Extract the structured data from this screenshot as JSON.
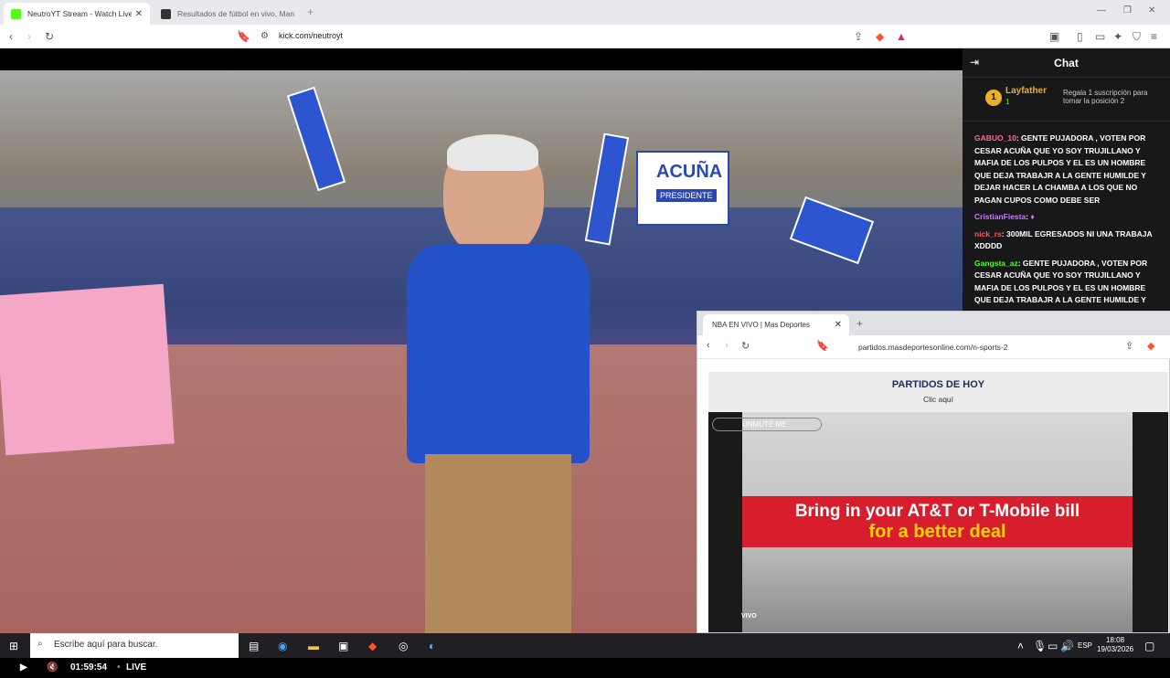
{
  "browser": {
    "tabs": [
      {
        "title": "NeutroYT Stream - Watch Live o",
        "favicon_color": "#53fc18"
      },
      {
        "title": "Resultados de fútbol en vivo, Marcad",
        "favicon_color": "#333333"
      }
    ],
    "url": "kick.com/neutroyt"
  },
  "video": {
    "time": "01:59:54",
    "live_label": "LIVE",
    "banner_name": "ACUÑA",
    "banner_role": "PRESIDENTE"
  },
  "chat": {
    "title": "Chat",
    "pinned": {
      "rank": "1",
      "user": "Layfather",
      "count": "1",
      "message": "Regala 1 suscripción para tomar la posición 2"
    },
    "messages": [
      {
        "user": "GABUO_10",
        "color": "#ff6b8a",
        "text": "GENTE PUJADORA , VOTEN POR CESAR ACUÑA QUE YO SOY TRUJILLANO Y MAFIA DE LOS PULPOS Y EL ES UN HOMBRE QUE DEJA TRABAJR A LA GENTE HUMILDE Y DEJAR HACER LA CHAMBA A LOS QUE NO PAGAN CUPOS COMO DEBE SER"
      },
      {
        "user": "CristianFiesta",
        "color": "#c77dff",
        "text": ""
      },
      {
        "user": "nick_rs",
        "color": "#ff5a5a",
        "text": "300MIL EGRESADOS NI UNA TRABAJA XDDDD"
      },
      {
        "user": "Gangsta_az",
        "color": "#53fc18",
        "text": "GENTE PUJADORA , VOTEN POR CESAR ACUÑA QUE YO SOY TRUJILLANO Y MAFIA DE LOS PULPOS Y EL ES UN HOMBRE QUE DEJA TRABAJR A LA GENTE HUMILDE Y"
      }
    ]
  },
  "pip": {
    "tab_title": "NBA EN VIVO | Mas Deportes",
    "url": "partidos.masdeportesonline.com/n-sports-2",
    "heading": "PARTIDOS DE HOY",
    "subheading": "Clic aquí",
    "unmute": "UNMUTE ME",
    "ad_line1": "Bring in your AT&T or T-Mobile bill",
    "ad_line2": "for a better deal",
    "vivo": "VIVO"
  },
  "taskbar": {
    "search_placeholder": "Escribe aquí para buscar.",
    "lang": "ESP",
    "time": "18:08",
    "date": "19/03/2026"
  }
}
